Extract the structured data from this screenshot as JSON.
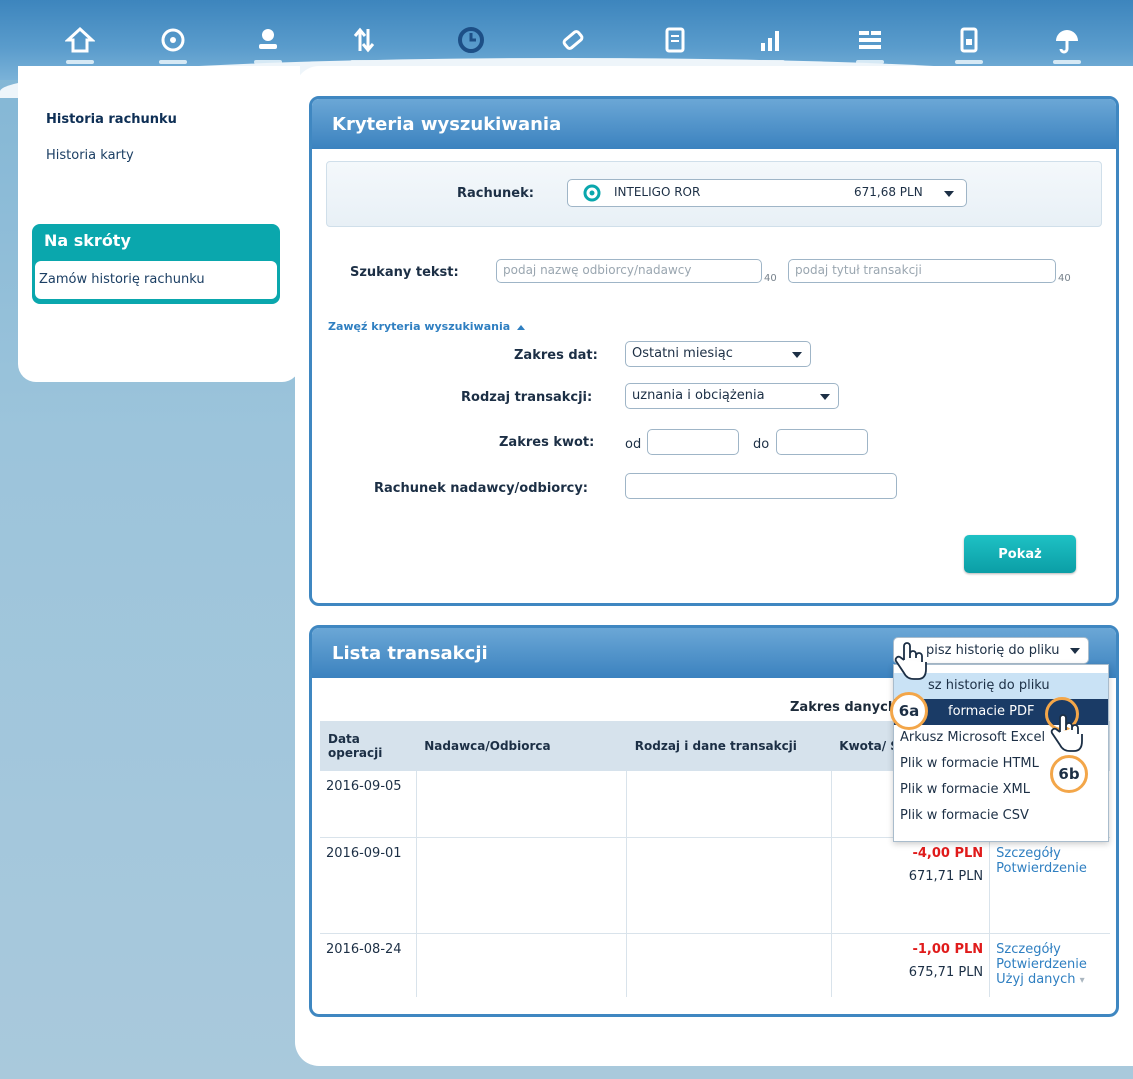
{
  "topnav": {
    "icons": [
      "home-icon",
      "cards-icon",
      "profile-icon",
      "transfers-icon",
      "history-icon",
      "payments-icon",
      "documents-icon",
      "savings-icon",
      "settings-icon",
      "mobile-icon",
      "insurance-icon"
    ],
    "active_index": 4
  },
  "sidebar": {
    "items": [
      {
        "label": "Historia rachunku",
        "active": true
      },
      {
        "label": "Historia karty",
        "active": false
      }
    ],
    "shortcuts_title": "Na skróty",
    "shortcuts_link": "Zamów historię rachunku"
  },
  "criteria": {
    "title": "Kryteria wyszukiwania",
    "account_label": "Rachunek:",
    "account_name": "INTELIGO ROR",
    "account_balance": "671,68 PLN",
    "search_label": "Szukany tekst:",
    "search_recipient_placeholder": "podaj nazwę odbiorcy/nadawcy",
    "search_title_placeholder": "podaj tytuł transakcji",
    "char_limit_1": "40",
    "char_limit_2": "40",
    "narrow_link": "Zawęź kryteria wyszukiwania",
    "date_range_label": "Zakres dat:",
    "date_range_value": "Ostatni miesiąc",
    "type_label": "Rodzaj transakcji:",
    "type_value": "uznania i obciążenia",
    "amount_label": "Zakres kwot:",
    "amount_from": "od",
    "amount_to": "do",
    "account_ref_label": "Rachunek nadawcy/odbiorcy:",
    "show_button": "Pokaż"
  },
  "transactions": {
    "title": "Lista transakcji",
    "save_select_value": "Zapisz historię do pliku",
    "range_label": "Zakres danych",
    "headers": {
      "date": "Data operacji",
      "party": "Nadawca/Odbiorca",
      "type": "Rodzaj i dane transakcji",
      "amount": "Kwota/ Saldo p",
      "actions": ""
    },
    "rows": [
      {
        "date": "2016-09-05",
        "party": "",
        "type": "",
        "amount": "",
        "balance": "",
        "links": []
      },
      {
        "date": "2016-09-01",
        "party": "",
        "type": "",
        "amount": "-4,00 PLN",
        "balance": "671,71 PLN",
        "links": [
          "Szczegóły",
          "Potwierdzenie"
        ]
      },
      {
        "date": "2016-08-24",
        "party": "",
        "type": "",
        "amount": "-1,00 PLN",
        "balance": "675,71 PLN",
        "links": [
          "Szczegóły",
          "Potwierdzenie",
          "Użyj danych"
        ]
      }
    ],
    "dropdown_options": [
      "Zapisz historię do pliku",
      "Plik w formacie PDF",
      "Arkusz Microsoft Excel",
      "Plik w formacie HTML",
      "Plik w formacie XML",
      "Plik w formacie CSV"
    ],
    "dropdown_visible": [
      "sz historię do pliku",
      "formacie PDF",
      "Arkusz Microsoft Excel",
      "Plik w formacie HTML",
      "Plik w formacie XML",
      "Plik w formacie CSV"
    ],
    "save_select_visible": "pisz historię do pliku",
    "badges": [
      "6a",
      "6b"
    ]
  },
  "colors": {
    "accent": "#3b82bf",
    "teal": "#0aa7ad",
    "negative": "#e01b1b",
    "link": "#2f7fc1",
    "badge_ring": "#f3a649"
  }
}
